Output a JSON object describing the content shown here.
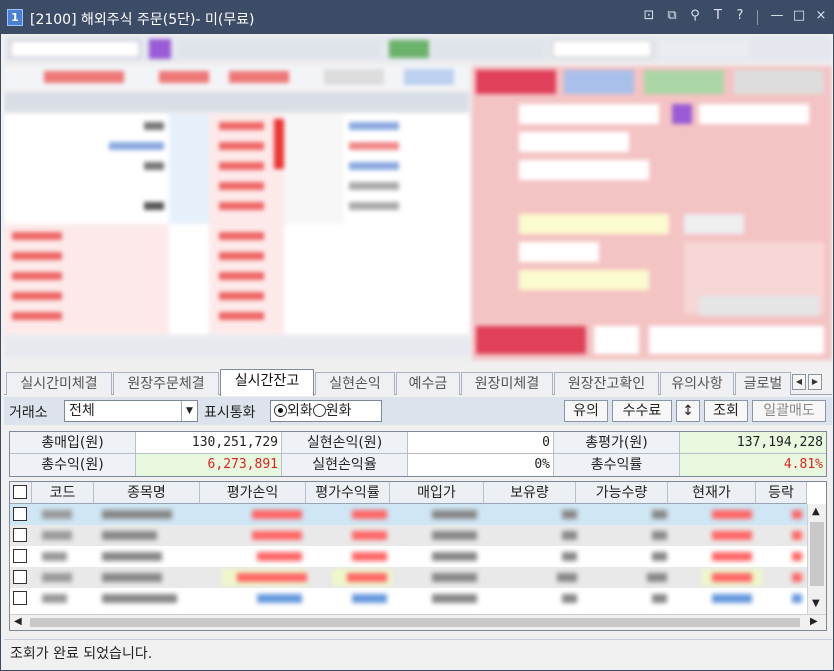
{
  "window": {
    "number": "1",
    "title": "[2100] 해외주식 주문(5단)- 미(무료)",
    "controls": [
      "⊡",
      "⧉",
      "⚲",
      "T",
      "?",
      "—",
      "□",
      "×"
    ]
  },
  "tabs": [
    "실시간미체결",
    "원장주문체결",
    "실시간잔고",
    "실현손익",
    "예수금",
    "원장미체결",
    "원장잔고확인",
    "유의사항",
    "글로벌"
  ],
  "active_tab": "실시간잔고",
  "tab_nav": [
    "◀",
    "▶"
  ],
  "controls": {
    "exchange_label": "거래소",
    "exchange_value": "전체",
    "currency_label": "표시통화",
    "currency_foreign": "외화",
    "currency_won": "원화",
    "currency_selected": "외화",
    "buttons": {
      "caution": "유의",
      "fee": "수수료",
      "sort": "↕",
      "query": "조회",
      "sell_all": "일괄매도"
    }
  },
  "summary": {
    "total_buy_label": "총매입(원)",
    "total_buy_value": "130,251,729",
    "realized_pl_label": "실현손익(원)",
    "realized_pl_value": "0",
    "total_eval_label": "총평가(원)",
    "total_eval_value": "137,194,228",
    "total_profit_label": "총수익(원)",
    "total_profit_value": "6,273,891",
    "realized_rate_label": "실현손익율",
    "realized_rate_value": "0%",
    "total_rate_label": "총수익률",
    "total_rate_value": "4.81%"
  },
  "grid": {
    "columns": [
      "코드",
      "종목명",
      "평가손익",
      "평가수익률",
      "매입가",
      "보유량",
      "가능수량",
      "현재가",
      "등락"
    ],
    "row_count": 5
  },
  "status_text": "조회가 완료 되었습니다.",
  "icons": [
    "window-number-icon",
    "checkbox-icon",
    "dropdown-arrow-icon",
    "radio-icon",
    "scroll-up-icon",
    "scroll-down-icon",
    "scroll-left-icon",
    "scroll-right-icon"
  ],
  "colors": {
    "title_bar": "#3c4c67",
    "profit_red": "#e0211f",
    "order_panel": "#f4c3c3",
    "profit_bg": "#e7f8df"
  }
}
